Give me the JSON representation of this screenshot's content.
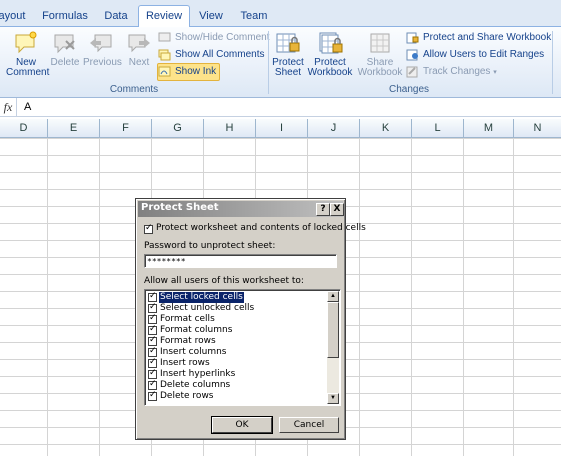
{
  "tabs": [
    {
      "label": "ayout"
    },
    {
      "label": "Formulas"
    },
    {
      "label": "Data"
    },
    {
      "label": "Review"
    },
    {
      "label": "View"
    },
    {
      "label": "Team"
    }
  ],
  "ribbon": {
    "comments": {
      "group_label": "Comments",
      "new_comment": "New\nComment",
      "new_comment_l1": "New",
      "new_comment_l2": "Comment",
      "delete": "Delete",
      "previous": "Previous",
      "next": "Next",
      "show_hide_comment": "Show/Hide Comment",
      "show_all_comments": "Show All Comments",
      "show_ink": "Show Ink"
    },
    "changes": {
      "group_label": "Changes",
      "protect_sheet_l1": "Protect",
      "protect_sheet_l2": "Sheet",
      "protect_workbook_l1": "Protect",
      "protect_workbook_l2": "Workbook",
      "share_workbook_l1": "Share",
      "share_workbook_l2": "Workbook",
      "protect_and_share": "Protect and Share Workbook",
      "allow_users": "Allow Users to Edit Ranges",
      "track_changes": "Track Changes"
    }
  },
  "formula_bar": {
    "fx": "fx",
    "value": "A"
  },
  "columns": [
    "D",
    "E",
    "F",
    "G",
    "H",
    "I",
    "J",
    "K",
    "L",
    "M",
    "N"
  ],
  "dialog": {
    "title": "Protect Sheet",
    "help": "?",
    "close": "X",
    "protect_checkbox_label": "Protect worksheet and contents of locked cells",
    "password_label": "Password to unprotect sheet:",
    "password_value": "********",
    "allow_label": "Allow all users of this worksheet to:",
    "options": [
      {
        "label": "Select locked cells",
        "checked": true,
        "selected": true
      },
      {
        "label": "Select unlocked cells",
        "checked": true
      },
      {
        "label": "Format cells",
        "checked": true
      },
      {
        "label": "Format columns",
        "checked": true
      },
      {
        "label": "Format rows",
        "checked": true
      },
      {
        "label": "Insert columns",
        "checked": true
      },
      {
        "label": "Insert rows",
        "checked": true
      },
      {
        "label": "Insert hyperlinks",
        "checked": true
      },
      {
        "label": "Delete columns",
        "checked": true
      },
      {
        "label": "Delete rows",
        "checked": true
      }
    ],
    "ok": "OK",
    "cancel": "Cancel"
  }
}
